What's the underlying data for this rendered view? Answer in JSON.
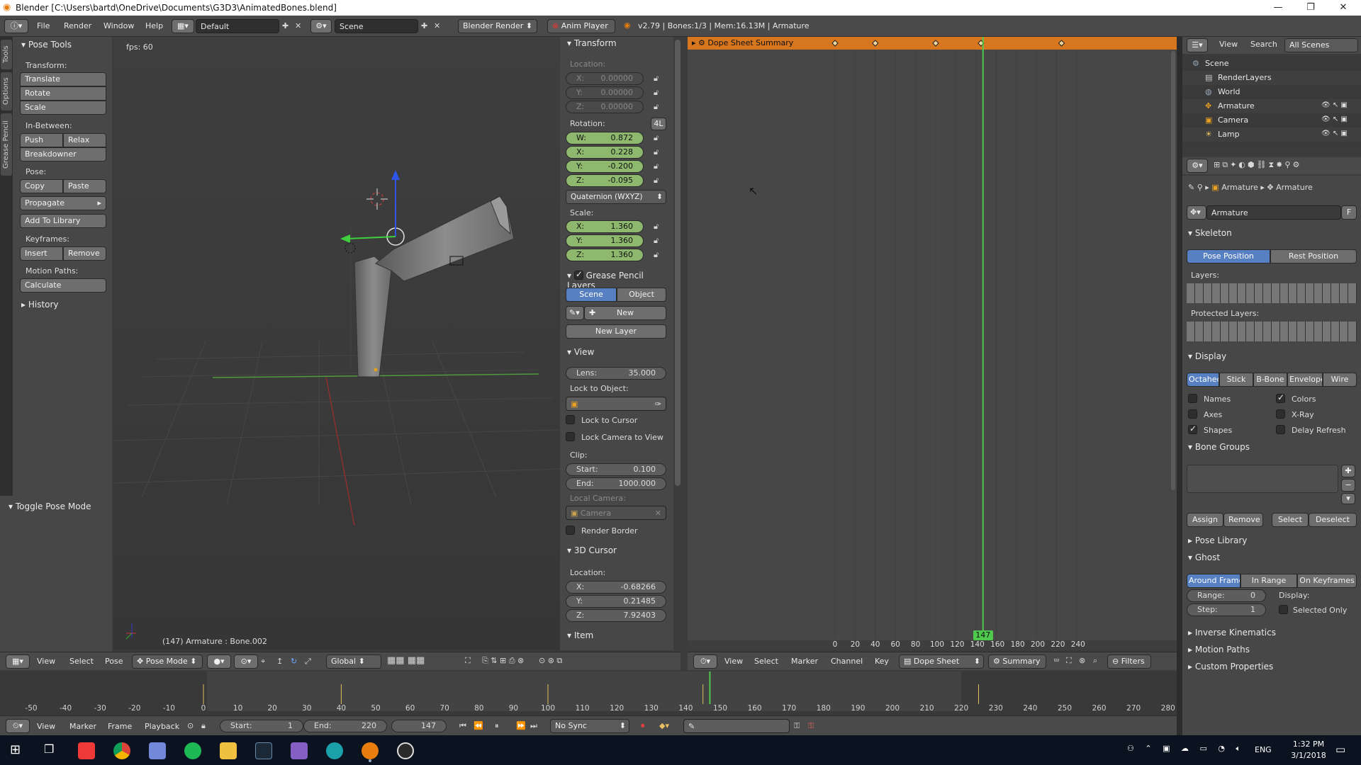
{
  "titlebar": {
    "title": "Blender [C:\\Users\\bartd\\OneDrive\\Documents\\G3D3\\AnimatedBones.blend]"
  },
  "infobar": {
    "menus": [
      "File",
      "Render",
      "Window",
      "Help"
    ],
    "layout": "Default",
    "scene": "Scene",
    "engine": "Blender Render",
    "anim_player": "Anim Player",
    "stats": "v2.79 | Bones:1/3 | Mem:16.13M | Armature"
  },
  "toolshelf": {
    "tabs": [
      "Tools",
      "Options",
      "Grease Pencil"
    ],
    "title": "Pose Tools",
    "transform_label": "Transform:",
    "translate": "Translate",
    "rotate": "Rotate",
    "scale": "Scale",
    "inbetween_label": "In-Between:",
    "push": "Push",
    "relax": "Relax",
    "breakdowner": "Breakdowner",
    "pose_label": "Pose:",
    "copy": "Copy",
    "paste": "Paste",
    "propagate": "Propagate",
    "add_to_library": "Add To Library",
    "keyframes_label": "Keyframes:",
    "insert": "Insert",
    "remove": "Remove",
    "motion_paths_label": "Motion Paths:",
    "calculate": "Calculate",
    "history": "History",
    "toggle_pose_mode": "Toggle Pose Mode"
  },
  "viewport": {
    "fps": "fps: 60",
    "object_info": "(147) Armature : Bone.002",
    "header": {
      "view": "View",
      "select": "Select",
      "pose": "Pose",
      "mode": "Pose Mode",
      "orientation": "Global"
    }
  },
  "npanel": {
    "transform": "Transform",
    "location_label": "Location:",
    "loc": {
      "x": "0.00000",
      "y": "0.00000",
      "z": "0.00000"
    },
    "rotation_label": "Rotation:",
    "rot_lock": "4L",
    "rot": {
      "w": "0.872",
      "x": "0.228",
      "y": "-0.200",
      "z": "-0.095"
    },
    "rotation_mode": "Quaternion (WXYZ)",
    "scale_label": "Scale:",
    "scale": {
      "x": "1.360",
      "y": "1.360",
      "z": "1.360"
    },
    "gp_layers": "Grease Pencil Layers",
    "gp_scene": "Scene",
    "gp_object": "Object",
    "gp_new": "New",
    "gp_new_layer": "New Layer",
    "view": "View",
    "lens_label": "Lens:",
    "lens": "35.000",
    "lock_to_object": "Lock to Object:",
    "lock_to_cursor": "Lock to Cursor",
    "lock_camera_to_view": "Lock Camera to View",
    "clip_label": "Clip:",
    "clip_start_label": "Start:",
    "clip_start": "0.100",
    "clip_end_label": "End:",
    "clip_end": "1000.000",
    "local_camera": "Local Camera:",
    "camera_field": "Camera",
    "render_border": "Render Border",
    "cursor_3d": "3D Cursor",
    "cursor_location_label": "Location:",
    "cursor": {
      "x": "-0.68266",
      "y": "0.21485",
      "z": "7.92403"
    },
    "item": "Item"
  },
  "dopesheet": {
    "summary": "Dope Sheet Summary",
    "current_frame": "147",
    "ruler": [
      "0",
      "20",
      "40",
      "60",
      "80",
      "100",
      "120",
      "140",
      "160",
      "180",
      "200",
      "220",
      "240"
    ],
    "keyframes": [
      0,
      40,
      100,
      145,
      225
    ],
    "header": {
      "view": "View",
      "select": "Select",
      "marker": "Marker",
      "channel": "Channel",
      "key": "Key",
      "mode": "Dope Sheet",
      "summary": "Summary",
      "filters": "Filters"
    }
  },
  "outliner": {
    "view": "View",
    "search": "Search",
    "scenes": "All Scenes",
    "items": [
      {
        "label": "Scene",
        "depth": 0
      },
      {
        "label": "RenderLayers",
        "depth": 1
      },
      {
        "label": "World",
        "depth": 1
      },
      {
        "label": "Armature",
        "depth": 1
      },
      {
        "label": "Camera",
        "depth": 1
      },
      {
        "label": "Lamp",
        "depth": 1
      }
    ]
  },
  "properties": {
    "breadcrumb": [
      "Armature",
      "Armature"
    ],
    "datablock": "Armature",
    "datablock_f": "F",
    "skeleton": "Skeleton",
    "pose_position": "Pose Position",
    "rest_position": "Rest Position",
    "layers_label": "Layers:",
    "protected_layers_label": "Protected Layers:",
    "display": "Display",
    "display_modes": [
      "Octahed",
      "Stick",
      "B-Bone",
      "Envelope",
      "Wire"
    ],
    "names": "Names",
    "colors": "Colors",
    "axes": "Axes",
    "xray": "X-Ray",
    "shapes": "Shapes",
    "delay_refresh": "Delay Refresh",
    "bone_groups": "Bone Groups",
    "assign": "Assign",
    "remove": "Remove",
    "select": "Select",
    "deselect": "Deselect",
    "pose_library": "Pose Library",
    "ghost": "Ghost",
    "ghost_modes": [
      "Around Frame",
      "In Range",
      "On Keyframes"
    ],
    "range_label": "Range:",
    "range": "0",
    "step_label": "Step:",
    "step": "1",
    "display_label": "Display:",
    "selected_only": "Selected Only",
    "inverse_kinematics": "Inverse Kinematics",
    "motion_paths": "Motion Paths",
    "custom_properties": "Custom Properties"
  },
  "timeline": {
    "ruler": [
      "-50",
      "-40",
      "-30",
      "-20",
      "-10",
      "0",
      "10",
      "20",
      "30",
      "40",
      "50",
      "60",
      "70",
      "80",
      "90",
      "100",
      "110",
      "120",
      "130",
      "140",
      "150",
      "160",
      "170",
      "180",
      "190",
      "200",
      "210",
      "220",
      "230",
      "240",
      "250",
      "260",
      "270",
      "280"
    ],
    "view": "View",
    "marker": "Marker",
    "frame": "Frame",
    "playback": "Playback",
    "start_label": "Start:",
    "start": "1",
    "end_label": "End:",
    "end": "220",
    "current": "147",
    "sync": "No Sync"
  },
  "taskbar": {
    "lang": "ENG",
    "time": "1:32 PM",
    "date": "3/1/2018"
  },
  "colors": {
    "accent_blue": "#5680c2",
    "field_green": "#8db86d",
    "current_frame": "#4ec94e",
    "keyframe": "#f0c860",
    "summary_orange": "#d6761f"
  }
}
